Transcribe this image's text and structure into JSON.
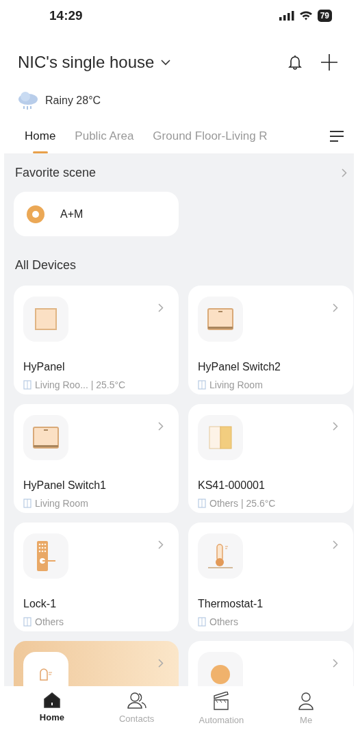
{
  "status_bar": {
    "time": "14:29",
    "battery": "79"
  },
  "home": {
    "title": "NIC's single house",
    "weather": "Rainy 28°C"
  },
  "tabs": [
    {
      "label": "Home",
      "selected": true
    },
    {
      "label": "Public Area",
      "selected": false
    },
    {
      "label": "Ground Floor-Living R",
      "selected": false
    }
  ],
  "favorite_scene": {
    "title": "Favorite scene",
    "scenes": [
      {
        "name": "A+M"
      }
    ]
  },
  "all_devices": {
    "title": "All Devices",
    "devices": [
      {
        "kind": "panel",
        "name": "HyPanel",
        "room": "Living Roo... | 25.5°C",
        "highlighted": false
      },
      {
        "kind": "switch",
        "name": "HyPanel Switch2",
        "room": "Living Room",
        "highlighted": false
      },
      {
        "kind": "switch",
        "name": "HyPanel Switch1",
        "room": "Living Room",
        "highlighted": false
      },
      {
        "kind": "dual",
        "name": "KS41-000001",
        "room": "Others | 25.6°C",
        "highlighted": false
      },
      {
        "kind": "lock",
        "name": "Lock-1",
        "room": "Others",
        "highlighted": false
      },
      {
        "kind": "thermostat",
        "name": "Thermostat-1",
        "room": "Others",
        "highlighted": false
      },
      {
        "kind": "sensor",
        "highlighted": true
      },
      {
        "kind": "round",
        "highlighted": false
      }
    ]
  },
  "bottom_nav": [
    {
      "label": "Home",
      "selected": true
    },
    {
      "label": "Contacts",
      "selected": false
    },
    {
      "label": "Automation",
      "selected": false
    },
    {
      "label": "Me",
      "selected": false
    }
  ]
}
